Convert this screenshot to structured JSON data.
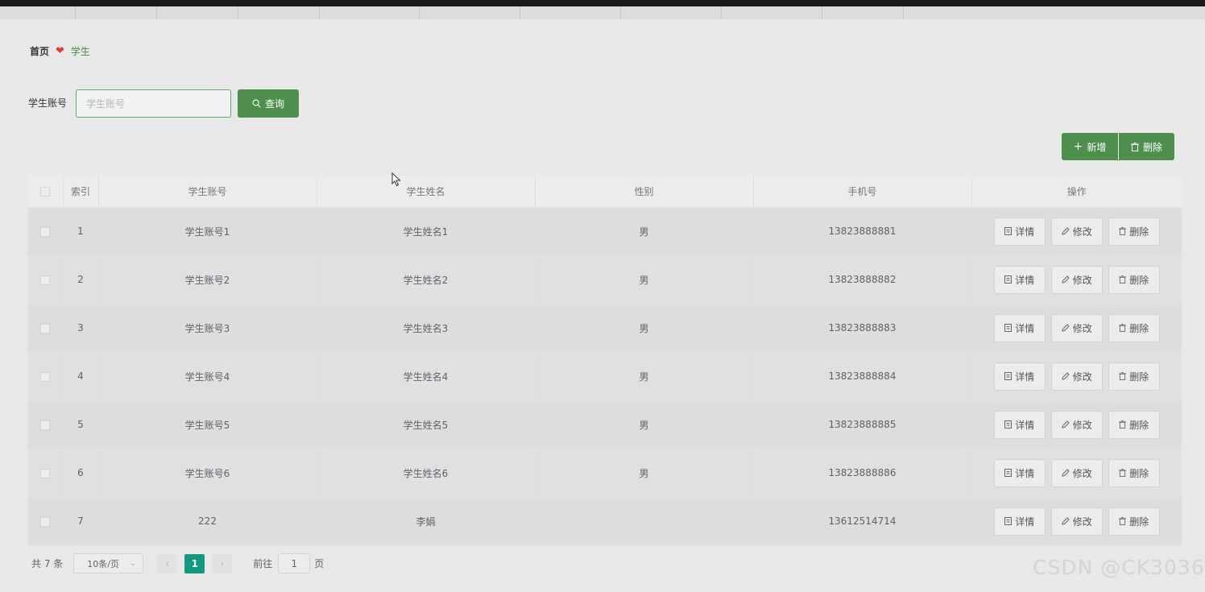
{
  "breadcrumb": {
    "home": "首页",
    "current": "学生"
  },
  "search": {
    "label": "学生账号",
    "placeholder": "学生账号",
    "button_label": "查询"
  },
  "toolbar": {
    "add_label": "新增",
    "delete_label": "删除"
  },
  "table": {
    "columns": [
      "索引",
      "学生账号",
      "学生姓名",
      "性别",
      "手机号",
      "操作"
    ],
    "rows": [
      {
        "index": "1",
        "account": "学生账号1",
        "name": "学生姓名1",
        "gender": "男",
        "phone": "13823888881"
      },
      {
        "index": "2",
        "account": "学生账号2",
        "name": "学生姓名2",
        "gender": "男",
        "phone": "13823888882"
      },
      {
        "index": "3",
        "account": "学生账号3",
        "name": "学生姓名3",
        "gender": "男",
        "phone": "13823888883"
      },
      {
        "index": "4",
        "account": "学生账号4",
        "name": "学生姓名4",
        "gender": "男",
        "phone": "13823888884"
      },
      {
        "index": "5",
        "account": "学生账号5",
        "name": "学生姓名5",
        "gender": "男",
        "phone": "13823888885"
      },
      {
        "index": "6",
        "account": "学生账号6",
        "name": "学生姓名6",
        "gender": "男",
        "phone": "13823888886"
      },
      {
        "index": "7",
        "account": "222",
        "name": "李娟",
        "gender": "",
        "phone": "13612514714"
      }
    ],
    "actions": {
      "detail": "详情",
      "edit": "修改",
      "delete": "删除"
    }
  },
  "pagination": {
    "total": "共 7 条",
    "page_size": "10条/页",
    "current_page": "1",
    "goto_label": "前往",
    "goto_value": "1",
    "page_unit": "页"
  },
  "watermark": "CSDN @CK3036",
  "colors": {
    "primary": "#4f8f4d",
    "page_active": "#12997f",
    "heart": "#e53935"
  }
}
